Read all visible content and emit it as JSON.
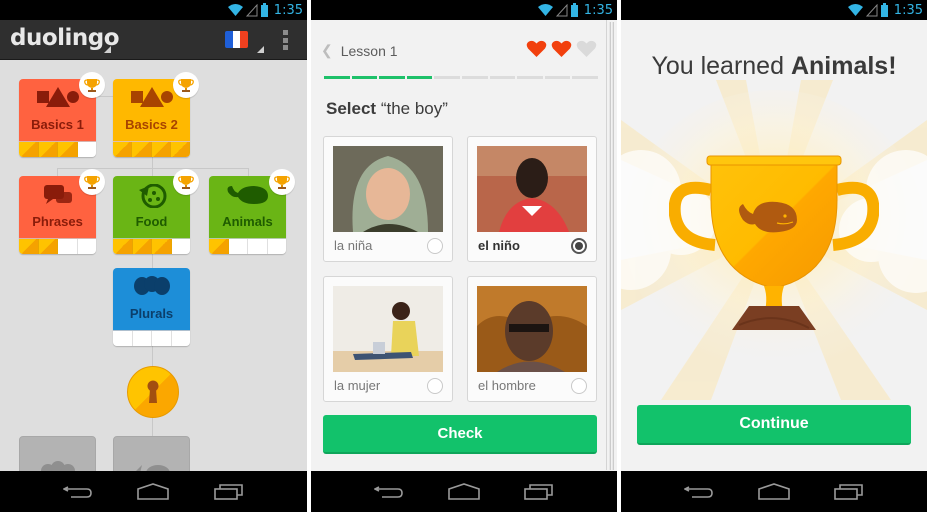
{
  "status_bar": {
    "time": "1:35"
  },
  "skill_tree": {
    "app_name": "duolingo",
    "language_flag": {
      "name": "French",
      "colors": [
        "#1f5fd8",
        "#ffffff",
        "#f0401f"
      ]
    },
    "skills": [
      {
        "name": "Basics 1",
        "icon": "shapes-icon",
        "color": "#ff6240",
        "text_color": "#8a1c0a",
        "strength": 3,
        "max_strength": 4,
        "trophy": true
      },
      {
        "name": "Basics 2",
        "icon": "shapes-icon",
        "color": "#ffb800",
        "text_color": "#a84400",
        "strength": 4,
        "max_strength": 4,
        "trophy": true
      },
      {
        "name": "Phrases",
        "icon": "speech-bubbles-icon",
        "color": "#ff6240",
        "text_color": "#8a1c0a",
        "strength": 2,
        "max_strength": 4,
        "trophy": true
      },
      {
        "name": "Food",
        "icon": "pizza-icon",
        "color": "#6ab515",
        "text_color": "#1f5c00",
        "strength": 3,
        "max_strength": 4,
        "trophy": true
      },
      {
        "name": "Animals",
        "icon": "whale-icon",
        "color": "#6ab515",
        "text_color": "#1f5c00",
        "strength": 1,
        "max_strength": 4,
        "trophy": true
      },
      {
        "name": "Plurals",
        "icon": "balloons-icon",
        "color": "#1d8ed8",
        "text_color": "#0b3f6b",
        "strength": 0,
        "max_strength": 4,
        "trophy": false
      }
    ],
    "checkpoint": "keyhole-lock-icon",
    "locked_skills": [
      {
        "icon": "locked-skill-icon"
      },
      {
        "icon": "locked-skill-icon"
      }
    ]
  },
  "lesson": {
    "title": "Lesson 1",
    "hearts": {
      "total": 3,
      "remaining": 2
    },
    "progress": {
      "done": 4,
      "total": 10
    },
    "prompt_bold": "Select",
    "prompt_rest": " “the boy”",
    "choices": [
      {
        "label": "la niña",
        "photo": "girl in headscarf",
        "selected": false
      },
      {
        "label": "el niño",
        "photo": "boy in red shirt",
        "selected": true
      },
      {
        "label": "la mujer",
        "photo": "woman with laptop",
        "selected": false
      },
      {
        "label": "el hombre",
        "photo": "man with glasses",
        "selected": false
      }
    ],
    "check_label": "Check"
  },
  "completion": {
    "headline_pre": "You learned ",
    "headline_bold": "Animals!",
    "trophy_icon": "whale-trophy-icon",
    "continue_label": "Continue"
  },
  "colors": {
    "green_button": "#12c26b",
    "heart_full": "#f2400d",
    "heart_empty": "#dadada",
    "progress_done": "#1ec16a",
    "status_time": "#33b5e5"
  }
}
